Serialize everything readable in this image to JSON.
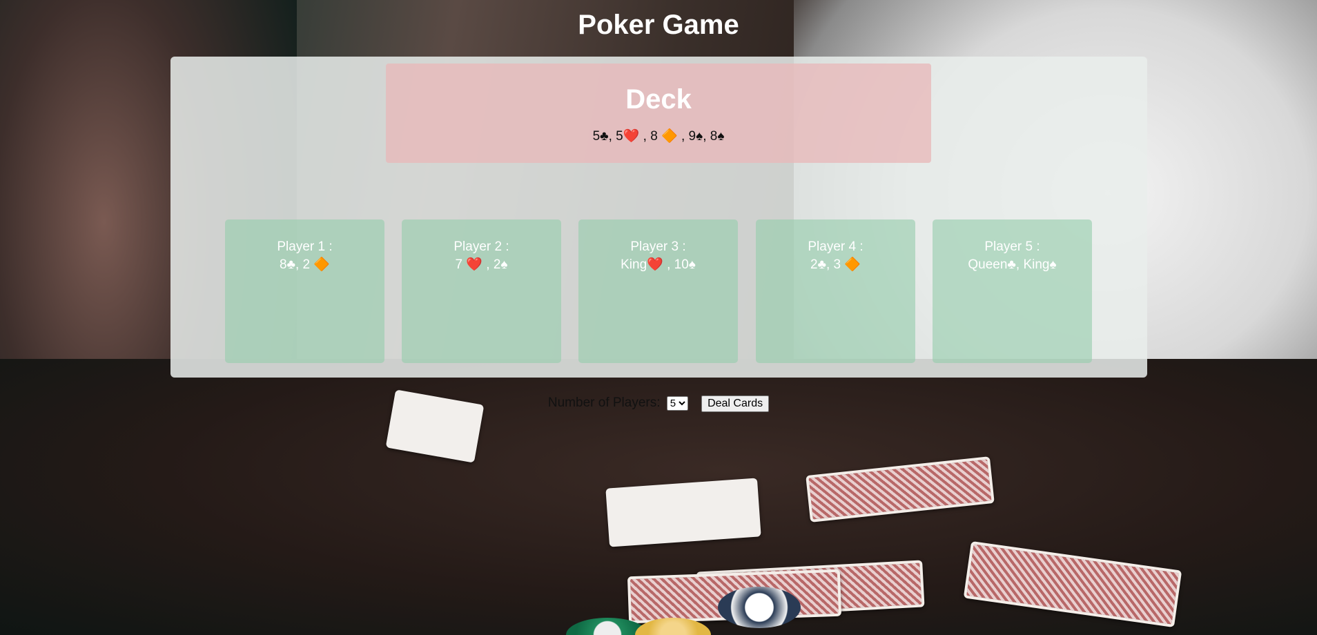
{
  "page": {
    "title": "Poker Game"
  },
  "deck": {
    "heading": "Deck",
    "cards": "5♣, 5❤️ , 8 🔶 , 9♠, 8♠"
  },
  "players": [
    {
      "label": "Player 1 :",
      "hand": "8♣, 2 🔶"
    },
    {
      "label": "Player 2 :",
      "hand": "7 ❤️ , 2♠"
    },
    {
      "label": "Player 3 :",
      "hand": "King❤️ , 10♠"
    },
    {
      "label": "Player 4 :",
      "hand": "2♣, 3 🔶"
    },
    {
      "label": "Player 5 :",
      "hand": "Queen♣, King♠"
    }
  ],
  "controls": {
    "players_label": "Number of Players:",
    "players_value": "5",
    "deal_label": "Deal Cards"
  }
}
